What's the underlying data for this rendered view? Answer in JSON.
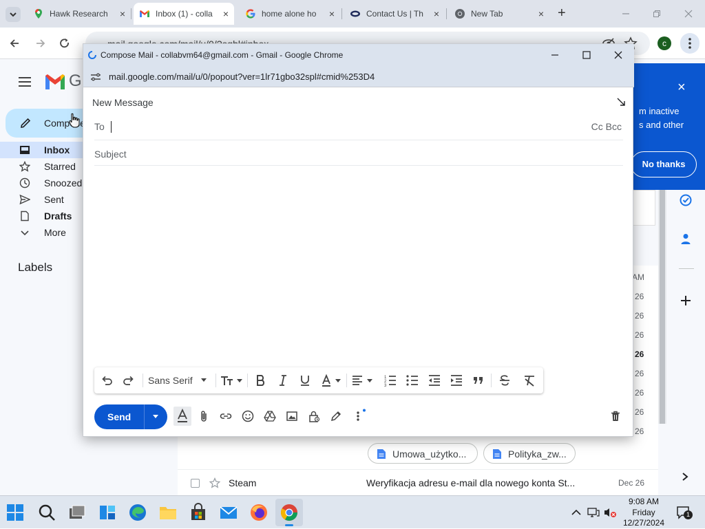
{
  "browser": {
    "tabs": [
      {
        "title": "Hawk Research",
        "close": "×"
      },
      {
        "title": "Inbox (1) - colla",
        "close": "×"
      },
      {
        "title": "home alone ho",
        "close": "×"
      },
      {
        "title": "Contact Us | Th",
        "close": "×"
      },
      {
        "title": "New Tab",
        "close": "×"
      }
    ],
    "new_tab": "+",
    "url": "mail.google.com/mail/u/0/?ogbl#inbox",
    "profile_initial": "c"
  },
  "gmail": {
    "logo_letter": "G",
    "compose_label": "Compose",
    "nav": [
      {
        "label": "Inbox"
      },
      {
        "label": "Starred"
      },
      {
        "label": "Snoozed"
      },
      {
        "label": "Sent"
      },
      {
        "label": "Drafts"
      },
      {
        "label": "More"
      }
    ],
    "labels_heading": "Labels",
    "promo": {
      "text_line1": "m inactive",
      "text_line2": "s and other",
      "button": "No thanks",
      "close": "×"
    },
    "dates": [
      "AM",
      "26",
      "26",
      "26",
      "26",
      "26",
      "26",
      "26",
      "26"
    ],
    "attachments": [
      "Umowa_użytko...",
      "Polityka_zw..."
    ],
    "row": {
      "sender": "Steam",
      "subject": "Weryfikacja adresu e-mail dla nowego konta St...",
      "date": "Dec 26"
    }
  },
  "compose": {
    "window_title": "Compose Mail - collabvm64@gmail.com - Gmail - Google Chrome",
    "url": "mail.google.com/mail/u/0/popout?ver=1lr71gbo32spl#cmid%253D4",
    "header": "New Message",
    "to_label": "To",
    "cc_bcc": "Cc Bcc",
    "subject_placeholder": "Subject",
    "font": "Sans Serif",
    "send": "Send"
  },
  "taskbar": {
    "time": "9:08 AM",
    "day": "Friday",
    "date": "12/27/2024",
    "notifications": "1"
  },
  "colors": {
    "accent": "#0b57d0",
    "tabstrip": "#dfe3eb",
    "compose_chrome": "#dbe3ee"
  }
}
